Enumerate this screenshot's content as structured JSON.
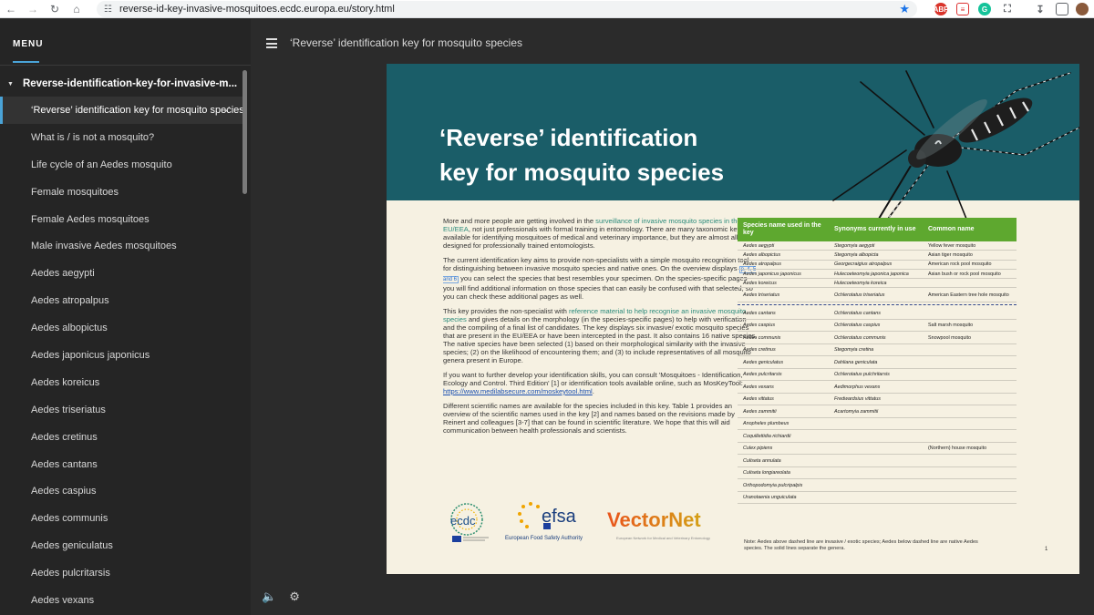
{
  "browser": {
    "url": "reverse-id-key-invasive-mosquitoes.ecdc.europa.eu/story.html",
    "extensions": [
      "ABP",
      "ext",
      "G",
      "puzzle"
    ]
  },
  "sidebar": {
    "menu_title": "MENU",
    "section_title": "Reverse-identification-key-for-invasive-m...",
    "items": [
      {
        "label": "‘Reverse’ identification key for mosquito species"
      },
      {
        "label": "What is / is not a mosquito?"
      },
      {
        "label": "Life cycle of an Aedes mosquito"
      },
      {
        "label": "Female mosquitoes"
      },
      {
        "label": "Female Aedes mosquitoes"
      },
      {
        "label": "Male invasive Aedes mosquitoes"
      },
      {
        "label": "Aedes aegypti"
      },
      {
        "label": "Aedes atropalpus"
      },
      {
        "label": "Aedes albopictus"
      },
      {
        "label": "Aedes japonicus japonicus"
      },
      {
        "label": "Aedes koreicus"
      },
      {
        "label": "Aedes triseriatus"
      },
      {
        "label": "Aedes cretinus"
      },
      {
        "label": "Aedes cantans"
      },
      {
        "label": "Aedes caspius"
      },
      {
        "label": "Aedes communis"
      },
      {
        "label": "Aedes geniculatus"
      },
      {
        "label": "Aedes pulcritarsis"
      },
      {
        "label": "Aedes vexans"
      }
    ],
    "active_index": 0
  },
  "main": {
    "lesson_title": "‘Reverse’ identification key for mosquito species"
  },
  "slide": {
    "title": "‘Reverse’ identification\nkey for mosquito species",
    "p1_a": "More and more people are getting involved in the ",
    "p1_hl": "surveillance of invasive mosquito species in the EU/EEA",
    "p1_b": ", not just professionals with formal training in entomology. There are many taxonomic keys available for identifying mosquitoes of medical and veterinary importance, but they are almost all designed for professionally trained entomologists.",
    "p2_a": "The current identification key aims to provide non-specialists with a simple mosquito recognition tool for distinguishing between invasive mosquito species and native ones. On the overview displays ",
    "p2_box": "p. 4, 5 and 6",
    "p2_b": " you can select the species that best resembles your specimen. On the species-specific pages you will find additional information on those species that can easily be confused with that selected, so you can check these additional pages as well.",
    "p3_a": "This key provides the non-specialist with ",
    "p3_hl": "reference material to help recognise an invasive mosquito species",
    "p3_b": " and gives details on the morphology (in the species-specific pages) to help with verification and the compiling of a final list of candidates. The key displays six invasive/ exotic mosquito species that are present in the EU/EEA or have been intercepted in the past. It also contains 16 native species. The native species have been selected (1) based on their morphological similarity with the invasive species; (2) on the likelihood of encountering them; and (3) to include representatives of all mosquito genera present in Europe.",
    "p4_a": "If you want to further develop your identification skills, you can consult 'Mosquitoes - Identification, Ecology and Control. Third Edition' [1] or identification tools available online, such as MosKeyTool: ",
    "p4_link": "https://www.medilabsecure.com/moskeytool.html",
    "p4_b": ".",
    "p5": "Different scientific names are available for the species included in this key. Table 1 provides an overview of the scientific names used in the key [2] and names based on the revisions made by Reinert and colleagues [3-7] that can be found in scientific literature. We hope that this will aid communication between health professionals and scientists.",
    "logo_ecdc": "ecdc",
    "logo_efsa": "efsa",
    "logo_efsa_sub": "European Food Safety Authority",
    "logo_vn": "VectorNet",
    "logo_vn_sub": "European Network for Medical and Veterinary Entomology",
    "table": {
      "headers": [
        "Species name used in the key",
        "Synonyms currently in use",
        "Common name"
      ],
      "invasive": [
        [
          "Aedes aegypti",
          "Stegomyia aegypti",
          "Yellow fever mosquito"
        ],
        [
          "Aedes albopictus",
          "Stegomyia albopicta",
          "Asian tiger mosquito"
        ],
        [
          "Aedes atropalpus",
          "Georgecraigius atropalpus",
          "American rock pool mosquito"
        ],
        [
          "Aedes japonicus japonicus",
          "Hulecoeteomyia japonica japonica",
          "Asian bush or rock pool mosquito"
        ],
        [
          "Aedes koreicus",
          "Hulecoeteomyia koreica",
          ""
        ],
        [
          "Aedes triseriatus",
          "Ochlerotatus triseriatus",
          "American Eastern tree hole mosquito"
        ]
      ],
      "native": [
        [
          "Aedes cantans",
          "Ochlerotatus cantans",
          ""
        ],
        [
          "Aedes caspius",
          "Ochlerotatus caspius",
          "Salt marsh mosquito"
        ],
        [
          "Aedes communis",
          "Ochlerotatus communis",
          "Snowpool mosquito"
        ],
        [
          "Aedes cretinus",
          "Stegomyia cretina",
          ""
        ],
        [
          "Aedes geniculatus",
          "Dahliana geniculata",
          ""
        ],
        [
          "Aedes pulcritarsis",
          "Ochlerotatus pulchritarsis",
          ""
        ],
        [
          "Aedes vexans",
          "Aedimorphus vexans",
          ""
        ],
        [
          "Aedes vittatus",
          "Fredwardsius vittatus",
          ""
        ],
        [
          "Aedes zammitii",
          "Acartomyia zammitii",
          ""
        ],
        [
          "Anopheles plumbeus",
          "",
          ""
        ],
        [
          "Coquillettidia richiardii",
          "",
          ""
        ],
        [
          "Culex pipiens",
          "",
          "(Northern) house mosquito"
        ],
        [
          "Culiseta annulata",
          "",
          ""
        ],
        [
          "Culiseta longiareolata",
          "",
          ""
        ],
        [
          "Orthopodomyia pulcripalpis",
          "",
          ""
        ],
        [
          "Uranotaenia unguiculata",
          "",
          ""
        ]
      ]
    },
    "note": "Note: Aedes above dashed line are invasive / exotic species; Aedes below dashed line are native Aedes species. The solid lines separate the genera.",
    "page_number": "1"
  },
  "colors": {
    "accent": "#4aa3d7",
    "header_teal": "#1a5d68",
    "table_green": "#5ea82f",
    "slide_bg": "#f6f1e2"
  }
}
